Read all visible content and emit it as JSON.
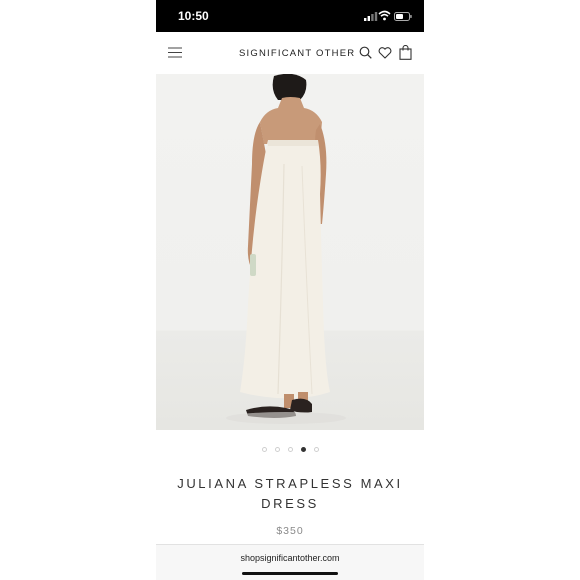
{
  "status_bar": {
    "time": "10:50"
  },
  "header": {
    "brand": "SIGNIFICANT OTHER"
  },
  "product": {
    "title": "JULIANA STRAPLESS MAXI DRESS",
    "price": "$350",
    "image_count": 5,
    "active_image": 4
  },
  "browser": {
    "url": "shopsignificantother.com"
  },
  "icons": [
    "menu-icon",
    "search-icon",
    "heart-icon",
    "bag-icon",
    "signal-icon",
    "wifi-icon",
    "battery-icon"
  ],
  "colors": {
    "dress": "#f3efe6",
    "background": "#f0f0ee",
    "dot_active": "#333333"
  }
}
